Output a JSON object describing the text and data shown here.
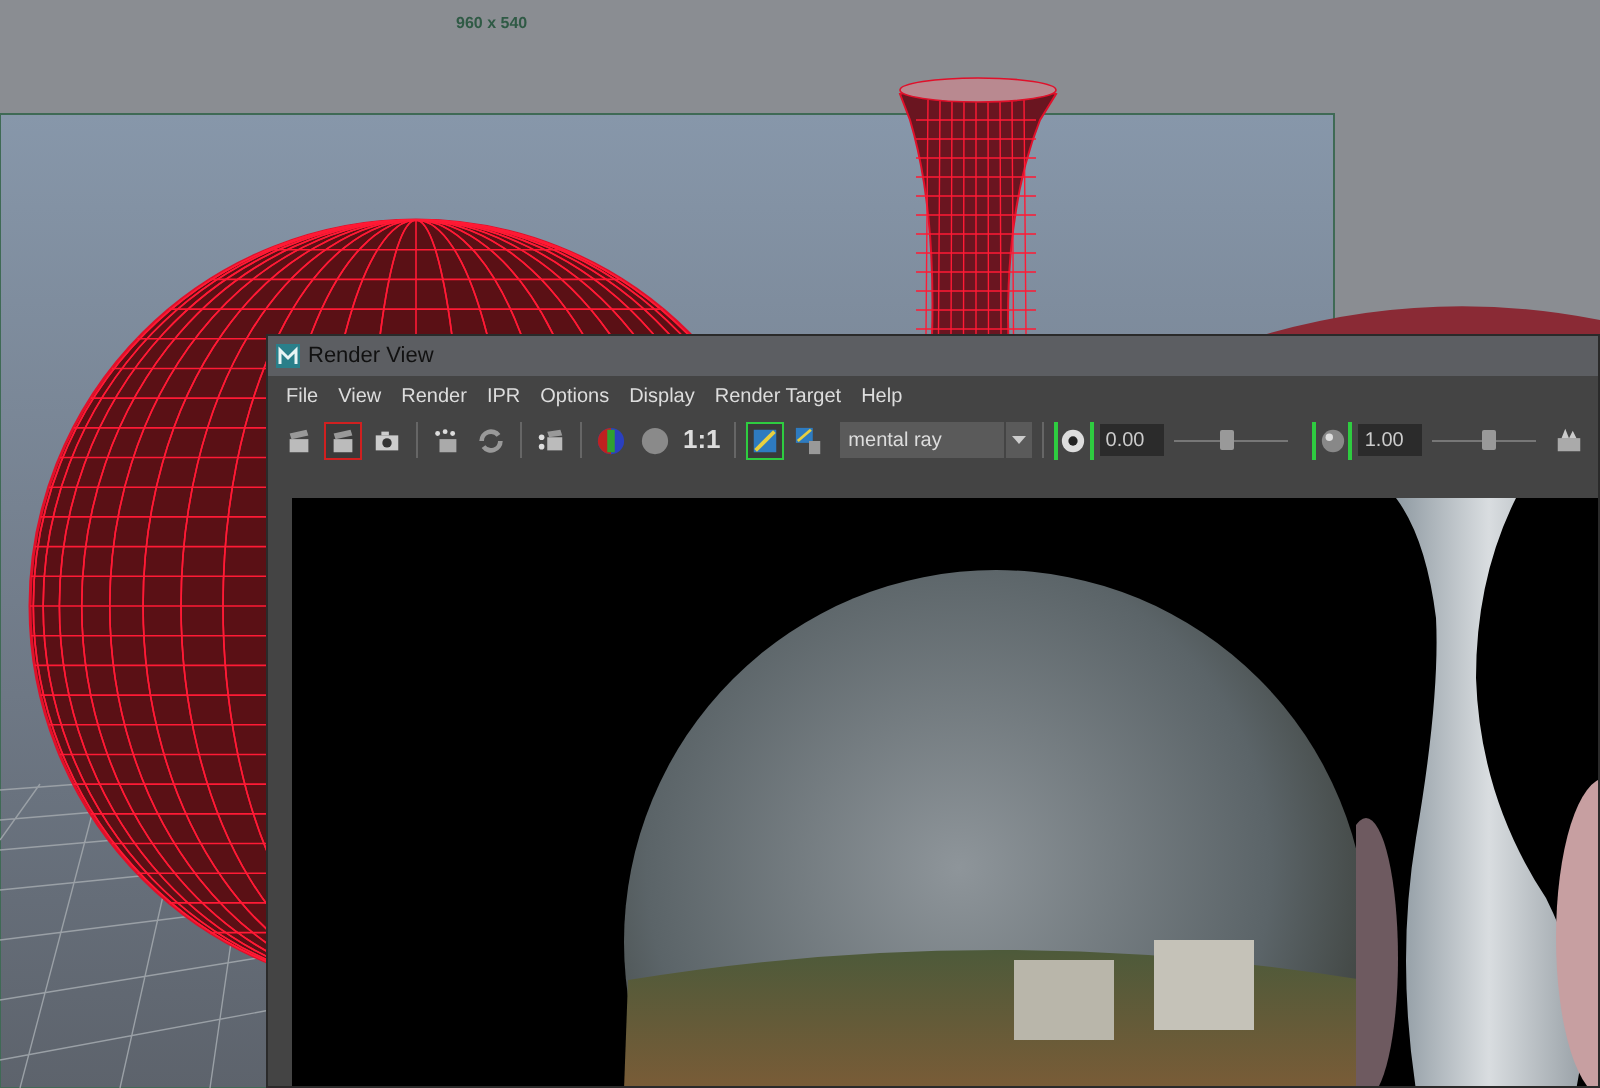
{
  "viewport": {
    "resolution_label": "960 x 540"
  },
  "render_view": {
    "title": "Render View",
    "menu": [
      "File",
      "View",
      "Render",
      "IPR",
      "Options",
      "Display",
      "Render Target",
      "Help"
    ],
    "tools": [
      {
        "kind": "clapper",
        "active": false
      },
      {
        "kind": "clapper",
        "active": true
      },
      {
        "kind": "camera",
        "active": false
      },
      {
        "kind": "separator"
      },
      {
        "kind": "ipr",
        "active": false
      },
      {
        "kind": "refresh",
        "active": false
      },
      {
        "kind": "separator"
      },
      {
        "kind": "sequence",
        "active": false
      },
      {
        "kind": "separator"
      },
      {
        "kind": "rgb",
        "active": false
      },
      {
        "kind": "alpha",
        "active": false
      },
      {
        "kind": "ratio",
        "label": "1:1"
      },
      {
        "kind": "separator"
      },
      {
        "kind": "frame",
        "active": true
      },
      {
        "kind": "remove",
        "active": false
      }
    ],
    "renderer": "mental ray",
    "exposure": {
      "on": true,
      "value": "0.00",
      "level": 0.45
    },
    "gamma": {
      "on": true,
      "value": "1.00",
      "level": 0.55
    }
  }
}
